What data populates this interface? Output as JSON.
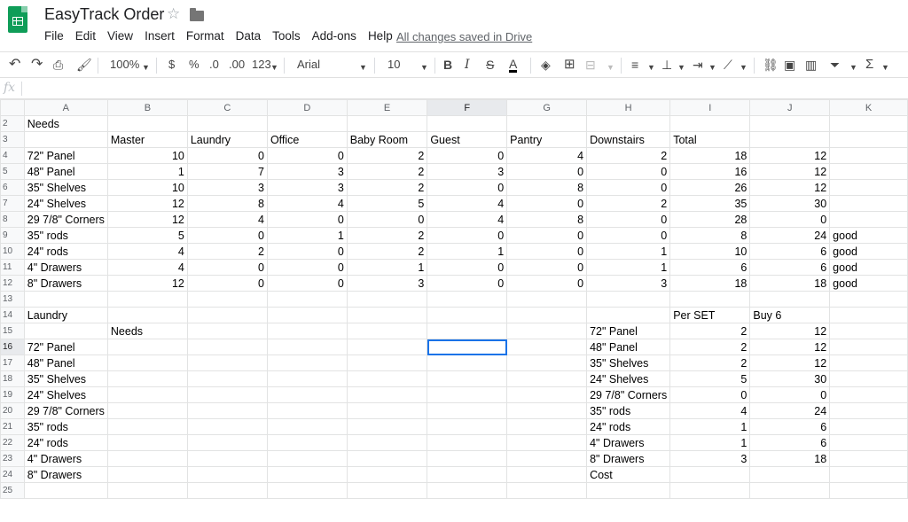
{
  "app": {
    "title": "EasyTrack Order",
    "saved_status": "All changes saved in Drive",
    "menu": [
      "File",
      "Edit",
      "View",
      "Insert",
      "Format",
      "Data",
      "Tools",
      "Add-ons",
      "Help"
    ]
  },
  "toolbar": {
    "zoom": "100%",
    "currency": "$",
    "percent": "%",
    "decrease_decimal": ".0",
    "increase_decimal": ".00",
    "more_formats": "123",
    "font": "Arial",
    "font_size": "10",
    "bold": "B",
    "italic": "I",
    "strike": "S",
    "text_color": "A",
    "functions": "Σ"
  },
  "formula_bar": {
    "label": "fx",
    "value": ""
  },
  "columns": [
    "A",
    "B",
    "C",
    "D",
    "E",
    "F",
    "G",
    "H",
    "I",
    "J",
    "K"
  ],
  "selected": {
    "row": 16,
    "col": "F"
  },
  "rows": [
    {
      "n": "2",
      "c": [
        "Needs",
        "",
        "",
        "",
        "",
        "",
        "",
        "",
        "",
        "",
        ""
      ]
    },
    {
      "n": "3",
      "c": [
        "",
        "Master",
        "Laundry",
        "Office",
        "Baby Room",
        "Guest",
        "Pantry",
        "Downstairs",
        "Total",
        "",
        ""
      ]
    },
    {
      "n": "4",
      "c": [
        "72\" Panel",
        "10",
        "0",
        "0",
        "2",
        "0",
        "4",
        "2",
        "18",
        "12",
        ""
      ]
    },
    {
      "n": "5",
      "c": [
        "48\" Panel",
        "1",
        "7",
        "3",
        "2",
        "3",
        "0",
        "0",
        "16",
        "12",
        ""
      ]
    },
    {
      "n": "6",
      "c": [
        "35\" Shelves",
        "10",
        "3",
        "3",
        "2",
        "0",
        "8",
        "0",
        "26",
        "12",
        ""
      ]
    },
    {
      "n": "7",
      "c": [
        "24\" Shelves",
        "12",
        "8",
        "4",
        "5",
        "4",
        "0",
        "2",
        "35",
        "30",
        ""
      ]
    },
    {
      "n": "8",
      "c": [
        "29 7/8\" Corners",
        "12",
        "4",
        "0",
        "0",
        "4",
        "8",
        "0",
        "28",
        "0",
        ""
      ]
    },
    {
      "n": "9",
      "c": [
        "35\" rods",
        "5",
        "0",
        "1",
        "2",
        "0",
        "0",
        "0",
        "8",
        "24",
        "good"
      ]
    },
    {
      "n": "10",
      "c": [
        "24\" rods",
        "4",
        "2",
        "0",
        "2",
        "1",
        "0",
        "1",
        "10",
        "6",
        "good"
      ]
    },
    {
      "n": "11",
      "c": [
        "4\" Drawers",
        "4",
        "0",
        "0",
        "1",
        "0",
        "0",
        "1",
        "6",
        "6",
        "good"
      ]
    },
    {
      "n": "12",
      "c": [
        "8\" Drawers",
        "12",
        "0",
        "0",
        "3",
        "0",
        "0",
        "3",
        "18",
        "18",
        "good"
      ]
    },
    {
      "n": "13",
      "c": [
        "",
        "",
        "",
        "",
        "",
        "",
        "",
        "",
        "",
        "",
        ""
      ]
    },
    {
      "n": "14",
      "c": [
        "Laundry",
        "",
        "",
        "",
        "",
        "",
        "",
        "",
        "Per SET",
        "Buy 6",
        ""
      ]
    },
    {
      "n": "15",
      "c": [
        "",
        "Needs",
        "",
        "",
        "",
        "",
        "",
        "72\" Panel",
        "2",
        "12",
        ""
      ]
    },
    {
      "n": "16",
      "c": [
        "72\" Panel",
        "",
        "",
        "",
        "",
        "",
        "",
        "48\" Panel",
        "2",
        "12",
        ""
      ]
    },
    {
      "n": "17",
      "c": [
        "48\" Panel",
        "",
        "",
        "",
        "",
        "",
        "",
        "35\" Shelves",
        "2",
        "12",
        ""
      ]
    },
    {
      "n": "18",
      "c": [
        "35\" Shelves",
        "",
        "",
        "",
        "",
        "",
        "",
        "24\" Shelves",
        "5",
        "30",
        ""
      ]
    },
    {
      "n": "19",
      "c": [
        "24\" Shelves",
        "",
        "",
        "",
        "",
        "",
        "",
        "29 7/8\" Corners",
        "0",
        "0",
        ""
      ]
    },
    {
      "n": "20",
      "c": [
        "29 7/8\" Corners",
        "",
        "",
        "",
        "",
        "",
        "",
        "35\" rods",
        "4",
        "24",
        ""
      ]
    },
    {
      "n": "21",
      "c": [
        "35\" rods",
        "",
        "",
        "",
        "",
        "",
        "",
        "24\" rods",
        "1",
        "6",
        ""
      ]
    },
    {
      "n": "22",
      "c": [
        "24\" rods",
        "",
        "",
        "",
        "",
        "",
        "",
        "4\" Drawers",
        "1",
        "6",
        ""
      ]
    },
    {
      "n": "23",
      "c": [
        "4\" Drawers",
        "",
        "",
        "",
        "",
        "",
        "",
        "8\" Drawers",
        "3",
        "18",
        ""
      ]
    },
    {
      "n": "24",
      "c": [
        "8\" Drawers",
        "",
        "",
        "",
        "",
        "",
        "",
        "Cost",
        "",
        "",
        ""
      ]
    },
    {
      "n": "25",
      "c": [
        "",
        "",
        "",
        "",
        "",
        "",
        "",
        "",
        "",
        "",
        ""
      ]
    }
  ]
}
